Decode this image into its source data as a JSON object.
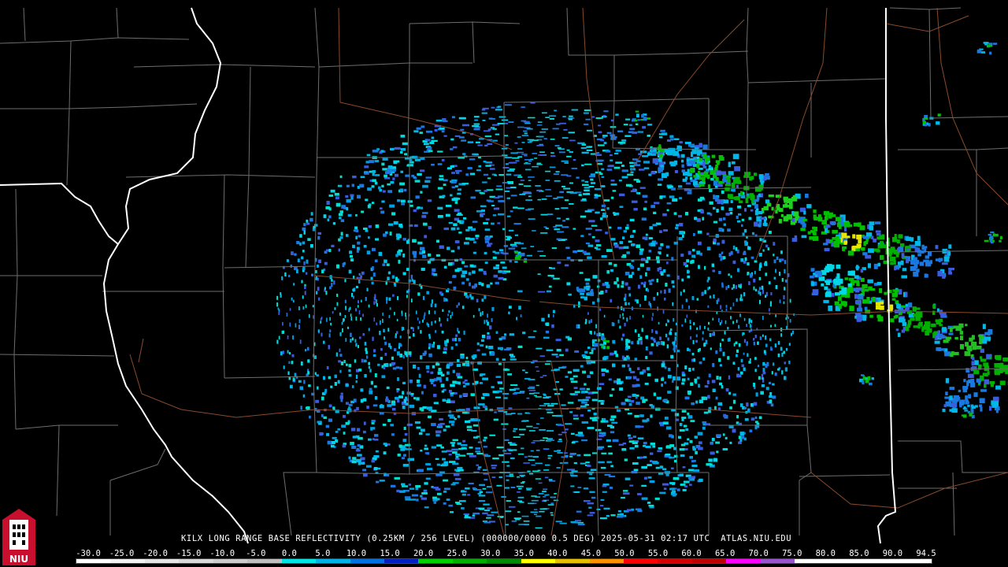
{
  "product": {
    "caption": "KILX LONG RANGE BASE REFLECTIVITY (0.25KM / 256 LEVEL) (000000/0000 0.5 DEG) 2025-05-31 02:17 UTC  ATLAS.NIU.EDU"
  },
  "logo": {
    "text": "NIU",
    "colors": {
      "red": "#c8102e",
      "white": "#ffffff",
      "black": "#000000"
    }
  },
  "colorbar": {
    "tick_labels": [
      "-30.0",
      "-25.0",
      "-20.0",
      "-15.0",
      "-10.0",
      "-5.0",
      "0.0",
      "5.0",
      "10.0",
      "15.0",
      "20.0",
      "25.0",
      "30.0",
      "35.0",
      "40.0",
      "45.0",
      "50.0",
      "55.0",
      "60.0",
      "65.0",
      "70.0",
      "75.0",
      "80.0",
      "85.0",
      "90.0",
      "94.5"
    ],
    "colors": [
      "#ffffff",
      "#f2f2f2",
      "#e5e5e5",
      "#d8d8d8",
      "#cccccc",
      "#bfbfbf",
      "#00e5e5",
      "#00b2e5",
      "#0070e0",
      "#0020c0",
      "#00d000",
      "#00b000",
      "#008c00",
      "#ffff00",
      "#e6c000",
      "#ff9000",
      "#ff0000",
      "#d60000",
      "#c00000",
      "#ff00ff",
      "#9955cc",
      "#ffffff",
      "#ffffff",
      "#ffffff",
      "#ffffff"
    ]
  },
  "map_colors": {
    "background": "#000000",
    "county_lines": "#707070",
    "state_lines": "#ffffff",
    "roads": "#8b4a2b"
  }
}
